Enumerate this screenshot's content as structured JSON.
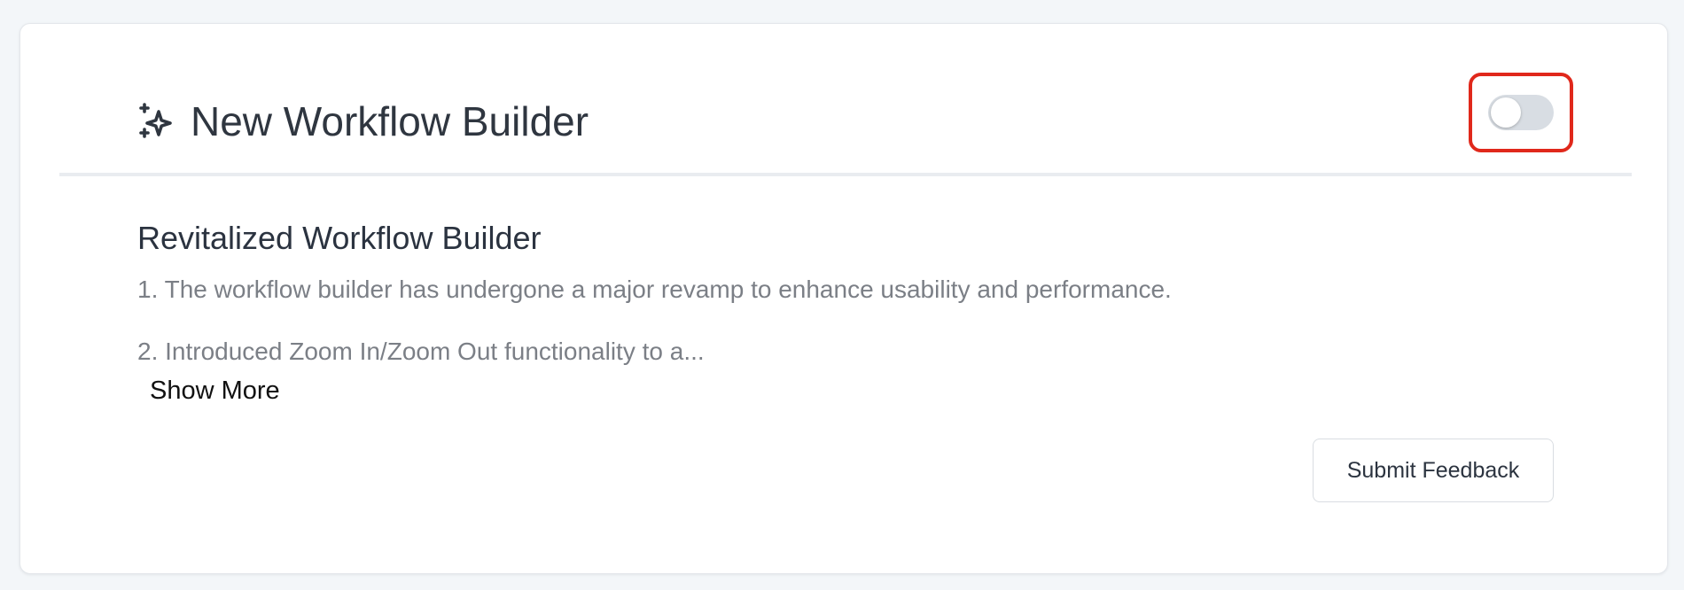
{
  "card": {
    "title": "New Workflow Builder",
    "icon": "sparkle-icon",
    "toggle": {
      "state": "off",
      "highlight_color": "#e0281b"
    }
  },
  "content": {
    "section_title": "Revitalized Workflow Builder",
    "items": [
      "1. The workflow builder has undergone a major revamp to enhance usability and performance.",
      "2. Introduced Zoom In/Zoom Out functionality to a..."
    ],
    "show_more_label": "Show More"
  },
  "actions": {
    "feedback_label": "Submit Feedback"
  }
}
